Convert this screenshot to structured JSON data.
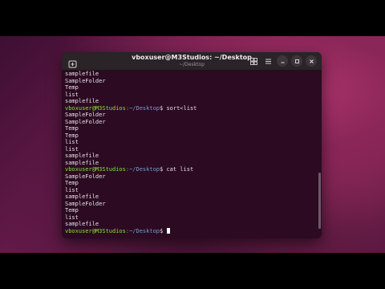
{
  "window": {
    "title": "vboxuser@M3Studios: ~/Desktop",
    "subtitle": "~/Desktop"
  },
  "icons": {
    "new_tab": "new-tab-icon",
    "split": "split-view-icon",
    "menu": "hamburger-menu-icon",
    "minimize": "minimize-icon",
    "maximize": "maximize-icon",
    "close": "close-icon"
  },
  "prompt": {
    "user": "vboxuser@M3Studios",
    "path": ":~/Desktop",
    "symbol": "$"
  },
  "lines": [
    {
      "type": "out",
      "text": "samplefile"
    },
    {
      "type": "out",
      "text": "SampleFolder"
    },
    {
      "type": "out",
      "text": "Temp"
    },
    {
      "type": "out",
      "text": "list"
    },
    {
      "type": "out",
      "text": "samplefile"
    },
    {
      "type": "cmd",
      "user": "vboxuser@M3Studios",
      "path": ":~/Desktop",
      "symbol": "$",
      "text": " sort<list"
    },
    {
      "type": "out",
      "text": "SampleFolder"
    },
    {
      "type": "out",
      "text": "SampleFolder"
    },
    {
      "type": "out",
      "text": "Temp"
    },
    {
      "type": "out",
      "text": "Temp"
    },
    {
      "type": "out",
      "text": "list"
    },
    {
      "type": "out",
      "text": "list"
    },
    {
      "type": "out",
      "text": "samplefile"
    },
    {
      "type": "out",
      "text": "samplefile"
    },
    {
      "type": "cmd",
      "user": "vboxuser@M3Studios",
      "path": ":~/Desktop",
      "symbol": "$",
      "text": " cat list"
    },
    {
      "type": "out",
      "text": "SampleFolder"
    },
    {
      "type": "out",
      "text": "Temp"
    },
    {
      "type": "out",
      "text": "list"
    },
    {
      "type": "out",
      "text": "samplefile"
    },
    {
      "type": "out",
      "text": "SampleFolder"
    },
    {
      "type": "out",
      "text": "Temp"
    },
    {
      "type": "out",
      "text": "list"
    },
    {
      "type": "out",
      "text": "samplefile"
    },
    {
      "type": "cmd",
      "user": "vboxuser@M3Studios",
      "path": ":~/Desktop",
      "symbol": "$",
      "text": " ",
      "cursor": true
    }
  ],
  "colors": {
    "prompt_user": "#8ae234",
    "prompt_path": "#729fcf",
    "terminal_bg": "#2b0a22",
    "text": "#e6e0e3"
  }
}
